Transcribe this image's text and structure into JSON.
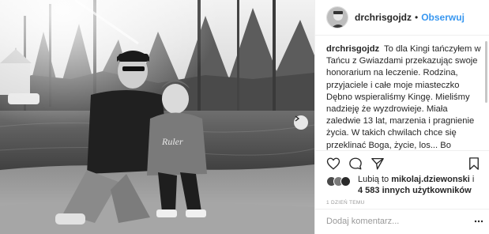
{
  "post": {
    "photo_alt": "black-and-white photo of a man and a girl crouching by a lake",
    "sweater_text": "Ruler"
  },
  "header": {
    "username": "drchrisgojdz",
    "separator": "•",
    "follow_label": "Obserwuj"
  },
  "caption": {
    "username": "drchrisgojdz",
    "text": "To dla Kingi tańczyłem w Tańcu z Gwiazdami przekazując swoje honorarium na leczenie. Rodzina, przyjaciele i całe moje miasteczko Dębno wspieraliśmy Kingę. Mieliśmy nadzieję że wyzdrowieje. Miała zaledwie 13 lat, marzenia i pragnienie życia. W takich chwilach chce się przeklinać Boga, życie, los... Bo dlaczego taka nieiwnna istota musiała przedwcześnie pożegnać się ze światem? Kolejna dziś smutna informacja."
  },
  "actions": {
    "like_icon": "heart-icon",
    "comment_icon": "comment-icon",
    "share_icon": "share-icon",
    "save_icon": "bookmark-icon"
  },
  "likes": {
    "prefix": "Lubią to ",
    "user": "mikolaj.dziewonski",
    "suffix": " i",
    "count": "4 583",
    "count_suffix": " innych użytkowników"
  },
  "timestamp": "1 DZIEŃ TEMU",
  "comment": {
    "placeholder": "Dodaj komentarz...",
    "value": ""
  },
  "colors": {
    "accent": "#3897f0",
    "text": "#262626",
    "muted": "#999999",
    "border": "#efefef"
  }
}
